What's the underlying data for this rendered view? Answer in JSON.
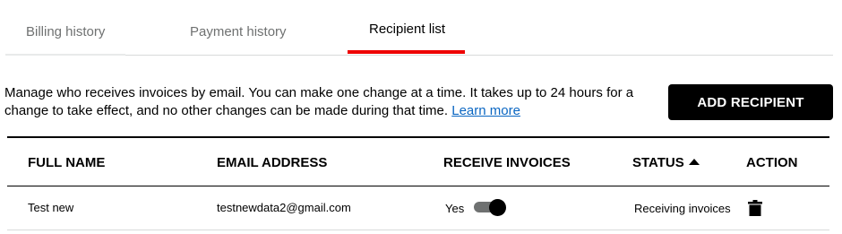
{
  "tabs": [
    {
      "label": "Billing history",
      "active": false
    },
    {
      "label": "Payment history",
      "active": false
    },
    {
      "label": "Recipient list",
      "active": true
    }
  ],
  "info": {
    "text": "Manage who receives invoices by email. You can make one change at a time. It takes up to 24 hours for a change to take effect, and no other changes can be made during that time.",
    "link_label": "Learn more"
  },
  "add_button_label": "ADD RECIPIENT",
  "table": {
    "headers": {
      "full_name": "FULL NAME",
      "email": "EMAIL ADDRESS",
      "receive_invoices": "RECEIVE INVOICES",
      "status": "STATUS",
      "action": "ACTION"
    },
    "sort": {
      "column": "status",
      "direction": "ascending",
      "icon": "caret-up-icon"
    },
    "rows": [
      {
        "full_name": "Test new",
        "email": "testnewdata2@gmail.com",
        "receive_invoices": "Yes",
        "toggle_on": true,
        "status": "Receiving invoices",
        "action_icon": "trash-icon"
      }
    ]
  },
  "colors": {
    "accent": "#ee0000",
    "link": "#0a66c2",
    "button_bg": "#000000",
    "inactive_tab": "#6f7171"
  }
}
